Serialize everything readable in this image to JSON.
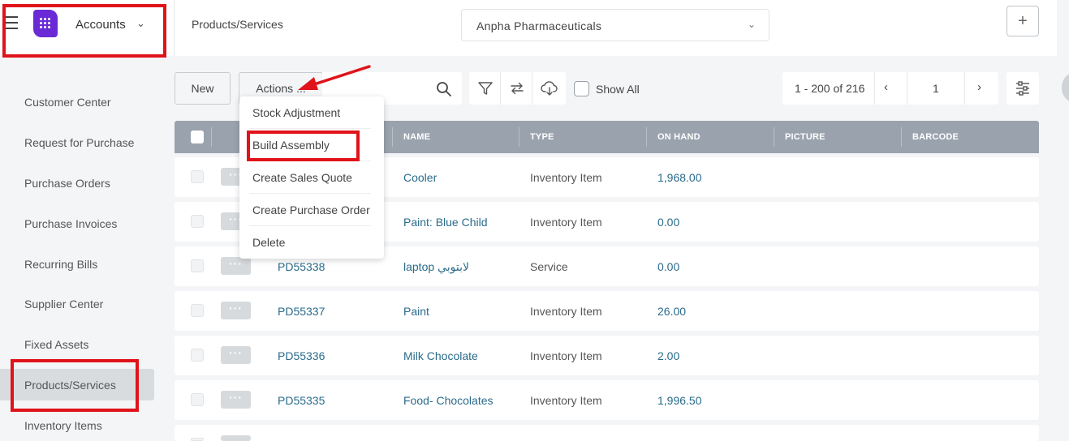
{
  "header": {
    "app_name": "Accounts",
    "breadcrumb": "Products/Services",
    "company": "Anpha Pharmaceuticals",
    "add_label": "+"
  },
  "sidebar": {
    "items": [
      {
        "label": "Customer Center"
      },
      {
        "label": "Request for Purchase"
      },
      {
        "label": "Purchase Orders"
      },
      {
        "label": "Purchase Invoices"
      },
      {
        "label": "Recurring Bills"
      },
      {
        "label": "Supplier Center"
      },
      {
        "label": "Fixed Assets"
      },
      {
        "label": "Products/Services",
        "active": true
      },
      {
        "label": "Inventory Items"
      }
    ]
  },
  "toolbar": {
    "new_label": "New",
    "actions_label": "Actions ...",
    "show_all_label": "Show All",
    "show_all_checked": false,
    "icons": [
      "filter-icon",
      "transfer-icon",
      "cloud-download-icon",
      "search-icon",
      "settings-sliders-icon"
    ]
  },
  "pagination": {
    "range": "1 - 200 of 216",
    "page": "1",
    "prev_label": "‹",
    "next_label": "›"
  },
  "actions_menu": {
    "items": [
      {
        "label": "Stock Adjustment"
      },
      {
        "label": "Build Assembly",
        "highlighted": true
      },
      {
        "label": "Create Sales Quote"
      },
      {
        "label": "Create Purchase Order"
      },
      {
        "label": "Delete"
      }
    ]
  },
  "table": {
    "columns": [
      "NAME",
      "TYPE",
      "ON HAND",
      "PICTURE",
      "BARCODE"
    ],
    "rows": [
      {
        "code": "",
        "name": "Cooler",
        "type": "Inventory Item",
        "on_hand": "1,968.00"
      },
      {
        "code": "",
        "name": "Paint: Blue Child",
        "type": "Inventory Item",
        "on_hand": "0.00"
      },
      {
        "code": "PD55338",
        "name": "laptop لابتوبي",
        "type": "Service",
        "on_hand": "0.00"
      },
      {
        "code": "PD55337",
        "name": "Paint",
        "type": "Inventory Item",
        "on_hand": "26.00"
      },
      {
        "code": "PD55336",
        "name": "Milk Chocolate",
        "type": "Inventory Item",
        "on_hand": "2.00"
      },
      {
        "code": "PD55335",
        "name": "Food- Chocolates",
        "type": "Inventory Item",
        "on_hand": "1,996.50"
      }
    ]
  },
  "colors": {
    "brand": "#6a2bd6",
    "highlight": "#e0131a",
    "link": "#2a6b8a",
    "table_header": "#9aa3ad"
  }
}
